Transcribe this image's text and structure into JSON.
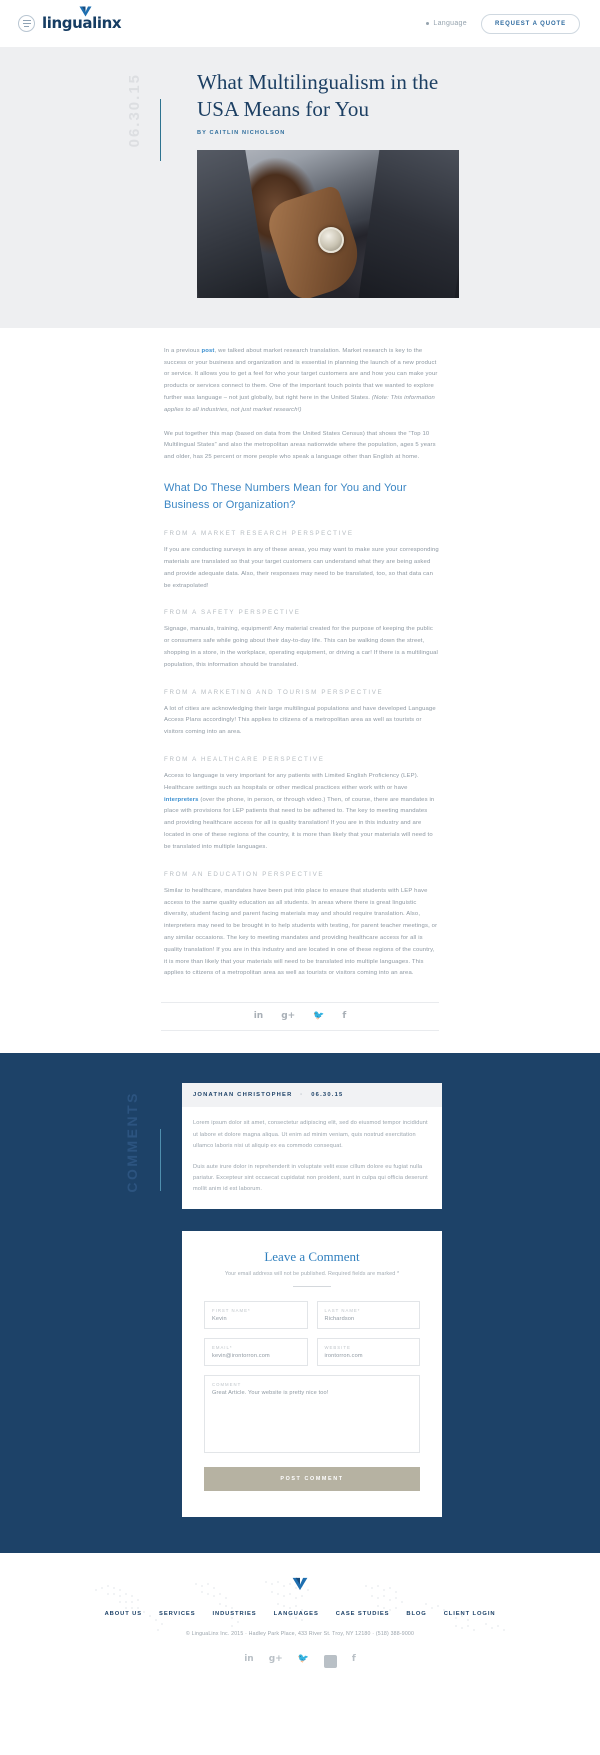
{
  "header": {
    "logo_text": "lingualinx",
    "menu_icon": "hamburger-icon",
    "language_label": "Language",
    "quote_button": "REQUEST A QUOTE"
  },
  "hero": {
    "date": "06.30.15",
    "title": "What Multilingualism in the USA Means for You",
    "byline": "BY CAITLIN NICHOLSON"
  },
  "article": {
    "p1_a": "In a previous ",
    "p1_link": "post",
    "p1_b": ", we talked about market research translation. Market research is key to the success or your business and organization and is essential in planning the launch of a new product or service. It allows you to get a feel for who your target customers are and how you can make your products or services connect to them. One of the important touch points that we wanted to explore further was language – not just globally, but right here in the United States. ",
    "p1_em": "(Note: This information applies to all industries, not just market research!)",
    "p2": "We put together this map (based on data from the United States Census) that shows the “Top 10 Multilingual States” and also the metropolitan areas nationwide where the population, ages 5 years and older, has 25 percent or more people who speak a language other than English at home.",
    "h2": "What Do These Numbers Mean for You and Your Business or Organization?",
    "sections": [
      {
        "heading": "FROM A MARKET RESEARCH PERSPECTIVE",
        "body": "If you are conducting surveys in any of these areas, you may want to make sure your corresponding materials are translated so that your target customers can understand what they are being asked and provide adequate data. Also, their responses may need to be translated, too, so that data can be extrapolated!"
      },
      {
        "heading": "FROM A SAFETY PERSPECTIVE",
        "body": "Signage, manuals, training, equipment! Any material created for the purpose of keeping the public or consumers safe while going about their day-to-day life. This can be walking down the street, shopping in a store, in the workplace, operating equipment, or driving a car! If there is a multilingual population, this information should be translated."
      },
      {
        "heading": "FROM A MARKETING AND TOURISM PERSPECTIVE",
        "body": "A lot of cities are acknowledging their large multilingual populations and have developed Language Access Plans accordingly! This applies to citizens of a metropolitan area as well as tourists or visitors coming into an area."
      },
      {
        "heading": "FROM A HEALTHCARE PERSPECTIVE",
        "body_a": "Access to language is very important for any patients with Limited English Proficiency (LEP). Healthcare settings such as hospitals or other medical practices either work with or have ",
        "body_link": "interpreters",
        "body_b": " (over the phone, in person, or through video.) Then, of course, there are mandates in place with provisions for LEP patients that need to be adhered to. The key to meeting mandates and providing healthcare access for all is quality translation! If you are in this industry and are located in one of these regions of the country, it is more than likely that your materials will need to be translated into multiple languages."
      },
      {
        "heading": "FROM AN EDUCATION PERSPECTIVE",
        "body": "Similar to healthcare, mandates have been put into place to ensure that students with LEP have access to the same quality education as all students. In areas where there is great linguistic diversity, student facing and parent facing materials may and should require translation. Also, interpreters may need to be brought in to help students with testing, for parent teacher meetings, or any similar occasions. The key to meeting mandates and providing healthcare access for all is quality translation! If you are in this industry and are located in one of these regions of the country, it is more than likely that your materials will need to be translated into multiple languages. This applies to citizens of a metropolitan area as well as tourists or visitors coming into an area."
      }
    ],
    "share_icons": [
      "linkedin-icon",
      "googleplus-icon",
      "twitter-icon",
      "facebook-icon"
    ]
  },
  "comments": {
    "rail_label": "COMMENTS",
    "entry": {
      "author": "JONATHAN CHRISTOPHER",
      "separator": "·",
      "date": "06.30.15",
      "paragraphs": [
        "Lorem ipsum dolor sit amet, consectetur adipiscing elit, sed do eiusmod tempor incididunt ut labore et dolore magna aliqua. Ut enim ad minim veniam, quis nostrud exercitation ullamco laboris nisi ut aliquip ex ea commodo consequat.",
        "Duis aute irure dolor in reprehenderit in voluptate velit esse cillum dolore eu fugiat nulla pariatur. Excepteur sint occaecat cupidatat non proident, sunt in culpa qui officia deserunt mollit anim id est laborum."
      ]
    }
  },
  "comment_form": {
    "title": "Leave a Comment",
    "note": "Your email address will not be published. Required fields are marked *",
    "fields": [
      {
        "label": "FIRST NAME*",
        "value": "Kevin",
        "name": "first-name-field"
      },
      {
        "label": "LAST NAME*",
        "value": "Richardson",
        "name": "last-name-field"
      },
      {
        "label": "EMAIL*",
        "value": "kevin@irontorron.com",
        "name": "email-field"
      },
      {
        "label": "WEBSITE",
        "value": "irontorron.com",
        "name": "website-field"
      }
    ],
    "comment_label": "COMMENT",
    "comment_value": "Great Article. Your website is pretty nice too!",
    "submit_label": "POST COMMENT"
  },
  "footer": {
    "nav": [
      "ABOUT US",
      "SERVICES",
      "INDUSTRIES",
      "LANGUAGES",
      "CASE STUDIES",
      "BLOG",
      "CLIENT LOGIN"
    ],
    "legal": "© LinguaLinx Inc. 2015   ·   Hadley Park Place, 433 River St. Troy, NY 12180   ·   (518) 388-9000",
    "social_icons": [
      "linkedin-icon",
      "googleplus-icon",
      "twitter-icon",
      "youtube-icon",
      "facebook-icon"
    ]
  },
  "colors": {
    "brand_navy": "#1d4268",
    "accent_blue": "#3b86c4",
    "hero_bg": "#eeeff1",
    "button_tan": "#b6b2a2"
  }
}
